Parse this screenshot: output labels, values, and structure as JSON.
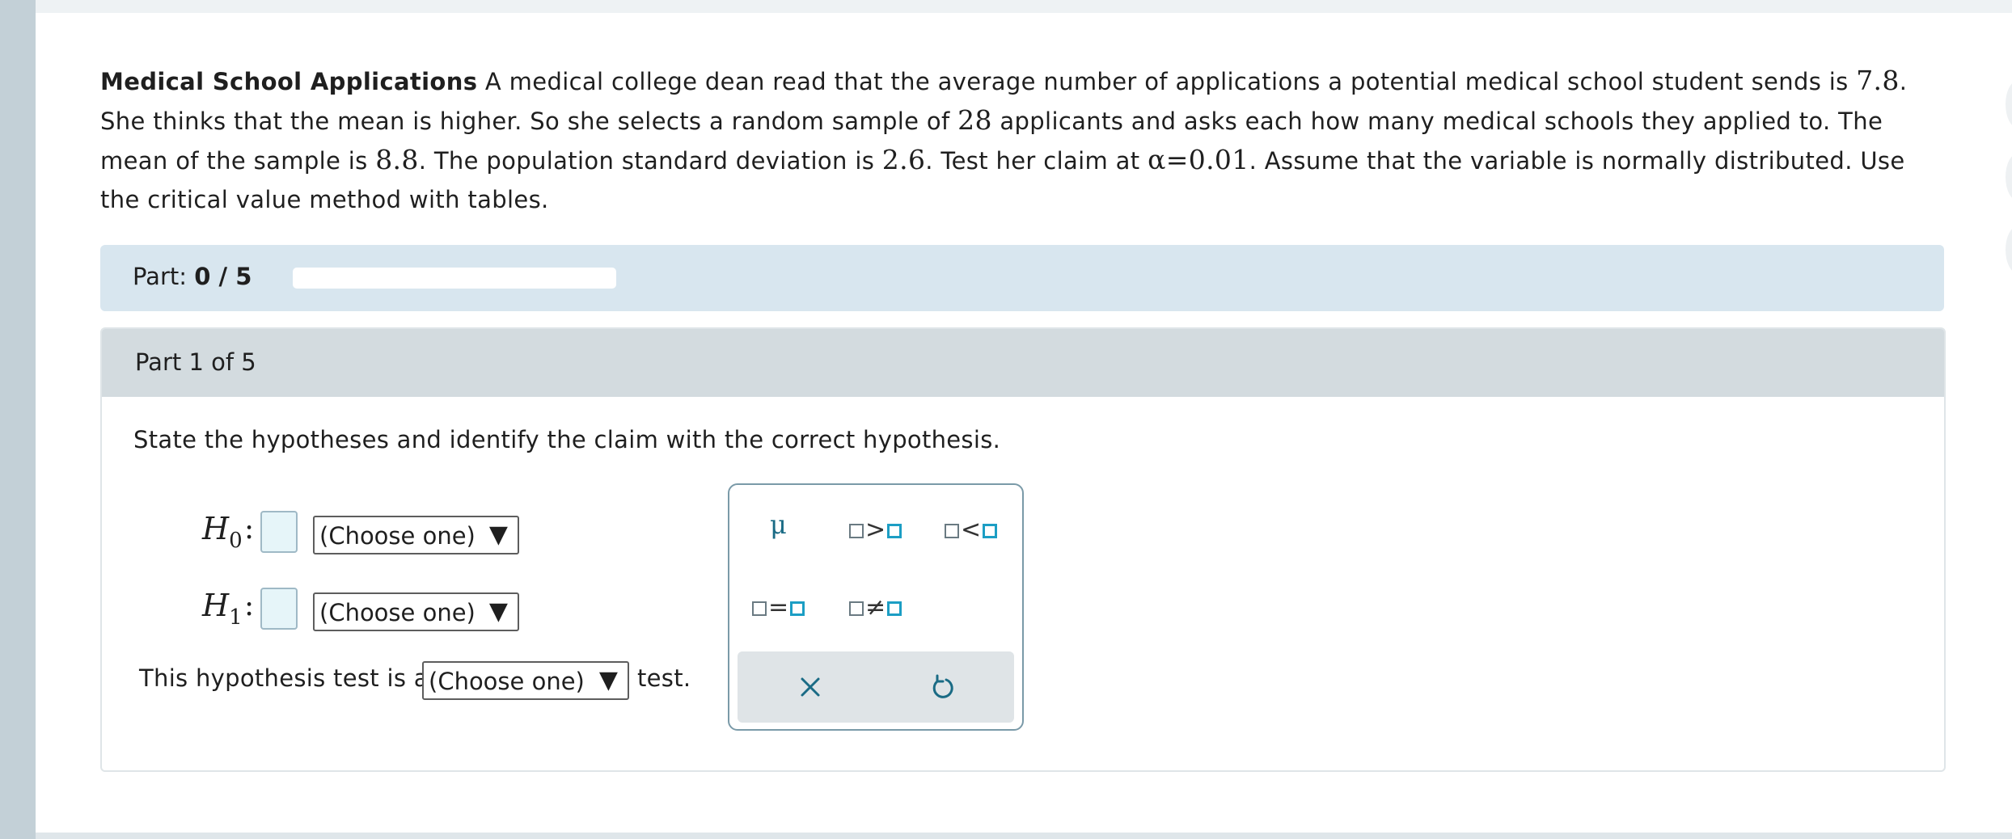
{
  "problem": {
    "title": "Medical School Applications",
    "seg1": "A medical college dean read that the average number of applications a potential medical school student sends is",
    "v1": "7.8",
    "seg2": ". She thinks that the mean is higher. So she selects a random sample of",
    "v2": "28",
    "seg3": "applicants and asks each how many medical schools they applied to. The mean of the sample is",
    "v3": "8.8",
    "seg4": ". The population standard deviation is",
    "v4": "2.6",
    "seg5": ". Test her claim at",
    "v5": "α=0.01",
    "seg6": ". Assume that the variable is normally distributed. Use the critical value method with tables."
  },
  "progress": {
    "label": "Part:",
    "value": "0 / 5",
    "fraction": 0
  },
  "part": {
    "header": "Part 1 of 5",
    "instruction": "State the hypotheses and identify the claim with the correct hypothesis."
  },
  "hypotheses": {
    "h0": {
      "var": "H",
      "sub": "0",
      "colon": ":",
      "select": "(Choose one)"
    },
    "h1": {
      "var": "H",
      "sub": "1",
      "colon": ":",
      "select": "(Choose one)"
    }
  },
  "test_type": {
    "pre": "This hypothesis test is a",
    "select": "(Choose one)",
    "post": "test."
  },
  "dropdown_arrow": "▼",
  "keypad": {
    "mu": "μ",
    "gt": ">",
    "lt": "<",
    "eq": "=",
    "neq": "≠",
    "clear_icon": "x-icon",
    "undo_icon": "undo-icon"
  },
  "colors": {
    "accent": "#1c9ec4",
    "progress_bg": "#d8e6ef",
    "header_bg": "#d3dbdf"
  }
}
